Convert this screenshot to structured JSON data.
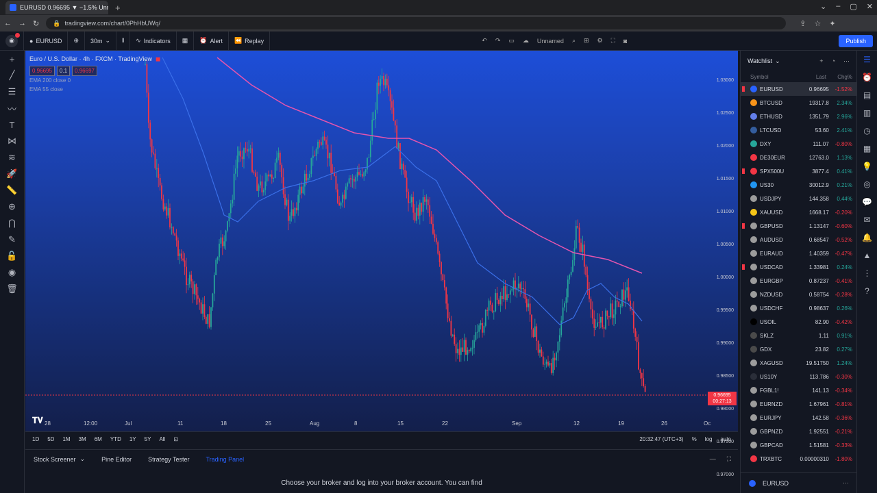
{
  "browser": {
    "tab_title": "EURUSD 0.96695 ▼ −1.5% Unnam",
    "url": "tradingview.com/chart/0PhHbUWq/"
  },
  "toolbar": {
    "symbol": "EURUSD",
    "interval": "30m",
    "indicators_label": "Indicators",
    "alert_label": "Alert",
    "replay_label": "Replay",
    "layout_name": "Unnamed",
    "publish_label": "Publish"
  },
  "legend": {
    "title": "Euro / U.S. Dollar · 4h · FXCM · TradingView",
    "bid": "0.96695",
    "spread": "0.1",
    "ask": "0.96697",
    "ema1": "EMA 200 close 0",
    "ema2": "EMA 55 close"
  },
  "price_axis": {
    "labels": [
      "1.03000",
      "1.02500",
      "1.02000",
      "1.01500",
      "1.01000",
      "1.00500",
      "1.00000",
      "0.99500",
      "0.99000",
      "0.98500",
      "0.98000",
      "0.97500",
      "0.97000"
    ],
    "current_price": "0.96695",
    "countdown": "00:27:13"
  },
  "time_axis": {
    "labels": [
      "28",
      "12:00",
      "Jul",
      "11",
      "18",
      "25",
      "Aug",
      "8",
      "15",
      "22",
      "Sep",
      "12",
      "19",
      "26",
      "Oc"
    ]
  },
  "range_bar": {
    "ranges": [
      "1D",
      "5D",
      "1M",
      "3M",
      "6M",
      "YTD",
      "1Y",
      "5Y",
      "All"
    ],
    "clock": "20:32:47 (UTC+3)",
    "percent": "%",
    "log": "log",
    "auto": "auto"
  },
  "bottom_tabs": [
    "Stock Screener",
    "Pine Editor",
    "Strategy Tester",
    "Trading Panel"
  ],
  "panel_text": "Choose your broker and log into your broker account. You can find",
  "watchlist": {
    "title": "Watchlist",
    "col_symbol": "Symbol",
    "col_last": "Last",
    "col_chg": "Chg%",
    "rows": [
      {
        "sym": "EURUSD",
        "last": "0.96695",
        "chg": "-1.52%",
        "dir": "dn",
        "color": "#2962ff",
        "flag": true,
        "sel": true
      },
      {
        "sym": "BTCUSD",
        "last": "19317.8",
        "chg": "2.34%",
        "dir": "up",
        "color": "#f7931a",
        "flag": false
      },
      {
        "sym": "ETHUSD",
        "last": "1351.79",
        "chg": "2.96%",
        "dir": "up",
        "color": "#627eea",
        "flag": false
      },
      {
        "sym": "LTCUSD",
        "last": "53.60",
        "chg": "2.41%",
        "dir": "up",
        "color": "#345d9d",
        "flag": false
      },
      {
        "sym": "DXY",
        "last": "111.07",
        "chg": "-0.80%",
        "dir": "dn",
        "color": "#26a69a",
        "flag": false
      },
      {
        "sym": "DE30EUR",
        "last": "12763.0",
        "chg": "1.13%",
        "dir": "up",
        "color": "#f23645",
        "flag": false
      },
      {
        "sym": "SPX500U",
        "last": "3877.4",
        "chg": "0.41%",
        "dir": "up",
        "color": "#f23645",
        "flag": true
      },
      {
        "sym": "US30",
        "last": "30012.9",
        "chg": "0.21%",
        "dir": "up",
        "color": "#2196f3",
        "flag": false
      },
      {
        "sym": "USDJPY",
        "last": "144.358",
        "chg": "0.44%",
        "dir": "up",
        "color": "#9c9c9c",
        "flag": false
      },
      {
        "sym": "XAUUSD",
        "last": "1668.17",
        "chg": "-0.20%",
        "dir": "dn",
        "color": "#f5c518",
        "flag": false
      },
      {
        "sym": "GBPUSD",
        "last": "1.13147",
        "chg": "-0.60%",
        "dir": "dn",
        "color": "#9c9c9c",
        "flag": true
      },
      {
        "sym": "AUDUSD",
        "last": "0.68547",
        "chg": "-0.52%",
        "dir": "dn",
        "color": "#9c9c9c",
        "flag": false
      },
      {
        "sym": "EURAUD",
        "last": "1.40359",
        "chg": "-0.47%",
        "dir": "dn",
        "color": "#9c9c9c",
        "flag": false
      },
      {
        "sym": "USDCAD",
        "last": "1.33981",
        "chg": "0.24%",
        "dir": "up",
        "color": "#9c9c9c",
        "flag": true
      },
      {
        "sym": "EURGBP",
        "last": "0.87237",
        "chg": "-0.41%",
        "dir": "dn",
        "color": "#9c9c9c",
        "flag": false
      },
      {
        "sym": "NZDUSD",
        "last": "0.58754",
        "chg": "-0.28%",
        "dir": "dn",
        "color": "#9c9c9c",
        "flag": false
      },
      {
        "sym": "USDCHF",
        "last": "0.98637",
        "chg": "0.26%",
        "dir": "up",
        "color": "#9c9c9c",
        "flag": false
      },
      {
        "sym": "USOIL",
        "last": "82.90",
        "chg": "-0.42%",
        "dir": "dn",
        "color": "#000000",
        "flag": false
      },
      {
        "sym": "SKLZ",
        "last": "1.11",
        "chg": "0.91%",
        "dir": "up",
        "color": "#4a4a4a",
        "flag": false
      },
      {
        "sym": "GDX",
        "last": "23.82",
        "chg": "0.27%",
        "dir": "up",
        "color": "#4a4a4a",
        "flag": false
      },
      {
        "sym": "XAGUSD",
        "last": "19.51750",
        "chg": "1.24%",
        "dir": "up",
        "color": "#9c9c9c",
        "flag": false
      },
      {
        "sym": "US10Y",
        "last": "113.786",
        "chg": "-0.30%",
        "dir": "dn",
        "color": "#2a2e39",
        "flag": false
      },
      {
        "sym": "FGBL1!",
        "last": "141.13",
        "chg": "-0.34%",
        "dir": "dn",
        "color": "#9c9c9c",
        "flag": false
      },
      {
        "sym": "EURNZD",
        "last": "1.67961",
        "chg": "-0.81%",
        "dir": "dn",
        "color": "#9c9c9c",
        "flag": false
      },
      {
        "sym": "EURJPY",
        "last": "142.58",
        "chg": "-0.36%",
        "dir": "dn",
        "color": "#9c9c9c",
        "flag": false
      },
      {
        "sym": "GBPNZD",
        "last": "1.92551",
        "chg": "-0.21%",
        "dir": "dn",
        "color": "#9c9c9c",
        "flag": false
      },
      {
        "sym": "GBPCAD",
        "last": "1.51581",
        "chg": "-0.33%",
        "dir": "dn",
        "color": "#9c9c9c",
        "flag": false
      },
      {
        "sym": "TRXBTC",
        "last": "0.00000310",
        "chg": "-1.80%",
        "dir": "dn",
        "color": "#f23645",
        "flag": false
      }
    ],
    "footer_symbol": "EURUSD"
  },
  "colors": {
    "accent": "#2962ff",
    "up": "#26a69a",
    "down": "#f23645",
    "ema_long": "#e455ae",
    "ema_short": "#3a6fe8"
  }
}
